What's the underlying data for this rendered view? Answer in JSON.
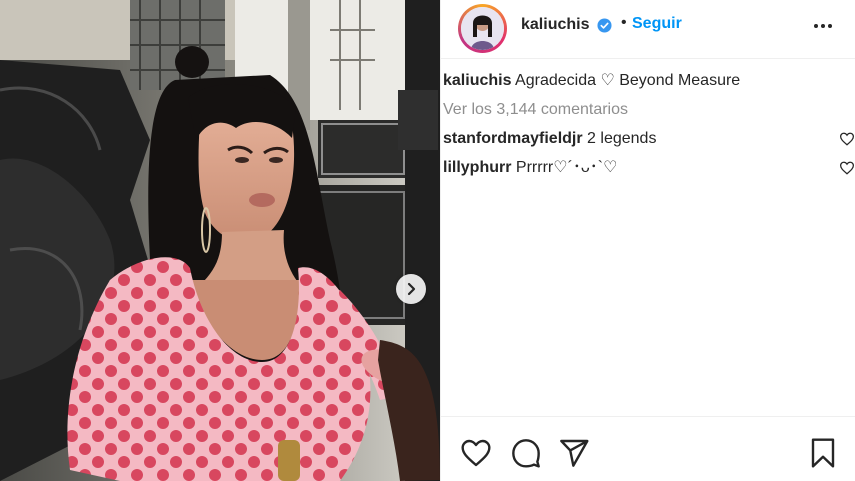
{
  "post": {
    "username": "kaliuchis",
    "follow_label": "Seguir",
    "separator": "•",
    "caption": "Agradecida ♡ Beyond Measure",
    "view_comments": "Ver los 3,144 comentarios"
  },
  "comments": [
    {
      "user": "stanfordmayfieldjr",
      "text": "2 legends"
    },
    {
      "user": "lillyphurr",
      "text": "Prrrrr♡´･ᴗ･`♡"
    }
  ],
  "icons": {
    "verified": "verified-badge-icon",
    "more": "more-options-icon",
    "next": "chevron-right-icon",
    "like": "heart-icon",
    "comment": "comment-icon",
    "share": "share-icon",
    "save": "bookmark-icon"
  },
  "colors": {
    "link_blue": "#0095f6",
    "text": "#262626",
    "muted": "#8e8e8e",
    "dress_pink": "#f6b7c1",
    "dress_dots": "#d9435d"
  }
}
